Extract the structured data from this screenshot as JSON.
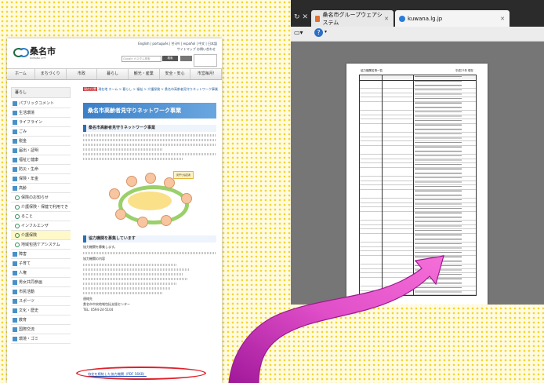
{
  "left_site": {
    "logo_text": "桑名市",
    "logo_sub": "KUWANA CITY",
    "top_links": "English | português | 한국어 | español | 中文 | 日本語",
    "top_links2": "サイトマップ お問い合わせ",
    "search_placeholder": "Google カスタム検索",
    "search_button": "検索",
    "nav": [
      "ホーム",
      "まちづくり",
      "市政",
      "暮らし",
      "観光・産業",
      "安全・安心",
      "市営毎月!"
    ],
    "sidebar_head": "暮らし",
    "sidebar_items": [
      {
        "label": "パブリックコメント",
        "type": "main"
      },
      {
        "label": "生活環境",
        "type": "main"
      },
      {
        "label": "ライフライン",
        "type": "main"
      },
      {
        "label": "ごみ",
        "type": "main"
      },
      {
        "label": "税金",
        "type": "main"
      },
      {
        "label": "届出・証明",
        "type": "main"
      },
      {
        "label": "福祉と健康",
        "type": "main"
      },
      {
        "label": "防災・生命",
        "type": "main"
      },
      {
        "label": "保険・年金",
        "type": "main"
      },
      {
        "label": "高齢",
        "type": "main"
      },
      {
        "label": "保険のお知らせ",
        "type": "sub"
      },
      {
        "label": "介護保険・保健で利用でき",
        "type": "sub"
      },
      {
        "label": "ること",
        "type": "sub"
      },
      {
        "label": "インフルエンザ",
        "type": "sub"
      },
      {
        "label": "介護保険",
        "type": "sub",
        "highlight": true
      },
      {
        "label": "地域包括ケアシステム",
        "type": "sub"
      },
      {
        "label": "障害",
        "type": "main"
      },
      {
        "label": "子育て",
        "type": "main"
      },
      {
        "label": "人権",
        "type": "main"
      },
      {
        "label": "男女共同参画",
        "type": "main"
      },
      {
        "label": "市民活動",
        "type": "main"
      },
      {
        "label": "スポーツ",
        "type": "main"
      },
      {
        "label": "文化・歴史",
        "type": "main"
      },
      {
        "label": "教育",
        "type": "main"
      },
      {
        "label": "国際交流",
        "type": "main"
      },
      {
        "label": "環境・ゴミ",
        "type": "main"
      }
    ],
    "breadcrumb_tag": "現在位置",
    "breadcrumb": "現在地 ホーム > 暮らし > 福祉 > 介護保険 > 桑名市高齢者見守りネットワーク事業",
    "page_title": "桑名市高齢者見守りネットワーク事業",
    "section1": "桑名市高齢者見守りネットワーク事業",
    "diagram_tag": "見守り協定者",
    "section2": "協力機関を募集しています",
    "text1": "協力機関を募集します。",
    "text2": "協力機関の内容",
    "text3": "連絡先",
    "contact1": "桑名市中央地域包括支援センター",
    "contact2": "TEL: 0594-24-5104",
    "pdf_link": "協定を締結した協力機関（PDF 56KB）"
  },
  "browser": {
    "tab1_label": "桑名市グループウェアシステム",
    "tab2_label": "kuwana.lg.jp",
    "page_heading_left": "協力機関名簿一覧",
    "page_heading_right": "平成27年 現在"
  },
  "colors": {
    "accent_red": "#e0202a",
    "arrow_purple": "#d33fc0",
    "banner_blue": "#3b7fc7"
  }
}
